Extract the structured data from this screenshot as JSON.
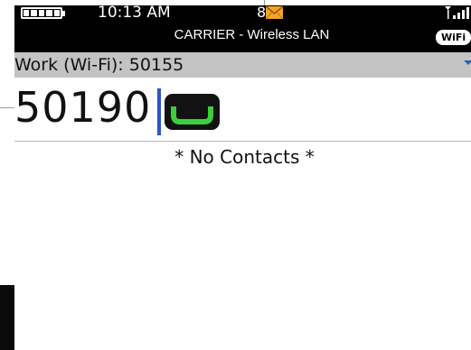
{
  "status_bar": {
    "time": "10:13 AM",
    "message_count": "8",
    "carrier": "CARRIER - Wireless LAN",
    "wifi_badge": "WiFi",
    "battery_icon": "battery-full-icon",
    "envelope_icon": "envelope-icon",
    "signal_icon": "signal-strength-icon"
  },
  "phone_line": {
    "label": "Work (Wi-Fi): 50155",
    "dropdown_icon": "chevron-down-icon"
  },
  "dialer": {
    "entered_number": "50190",
    "call_icon": "phone-call-icon"
  },
  "contacts": {
    "empty_message": "* No Contacts *"
  },
  "colors": {
    "status_bar_bg": "#000000",
    "line_bar_bg": "#c3c3c3",
    "envelope": "#f2a32a",
    "call_accent": "#3ccf3c",
    "cursor": "#2a55c4"
  }
}
